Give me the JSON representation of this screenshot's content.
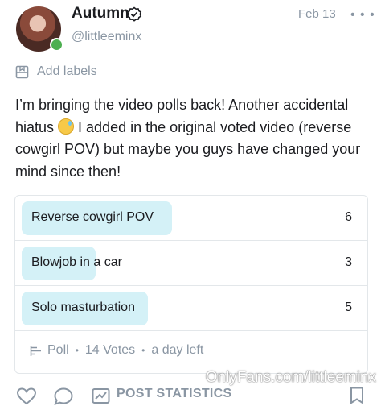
{
  "author": {
    "name": "Autumn",
    "handle": "@littleeminx",
    "verified_icon": "verified-badge-icon",
    "online": true,
    "status_color": "#4caf50"
  },
  "post": {
    "date": "Feb 13",
    "add_labels": "Add labels",
    "text_before_emoji": "I’m bringing the video polls back! Another accidental hiatus ",
    "emoji": "sweat-smile-emoji",
    "text_after_emoji": " I added in the original voted video (reverse cowgirl POV) but maybe you guys have changed your mind since then!"
  },
  "poll": {
    "options": [
      {
        "label": "Reverse cowgirl POV",
        "votes": "6",
        "share": 0.43
      },
      {
        "label": "Blowjob in a car",
        "votes": "3",
        "share": 0.21
      },
      {
        "label": "Solo masturbation",
        "votes": "5",
        "share": 0.36
      }
    ],
    "type_label": "Poll",
    "votes_text": "14 Votes",
    "time_left": "a day left",
    "bar_color": "#d4f1f7"
  },
  "actions": {
    "post_statistics": "POST STATISTICS"
  },
  "watermark": "OnlyFans.com/littleeminx",
  "colors": {
    "muted": "#8a96a3",
    "text": "#1b1c20",
    "accent": "#00aff0"
  }
}
